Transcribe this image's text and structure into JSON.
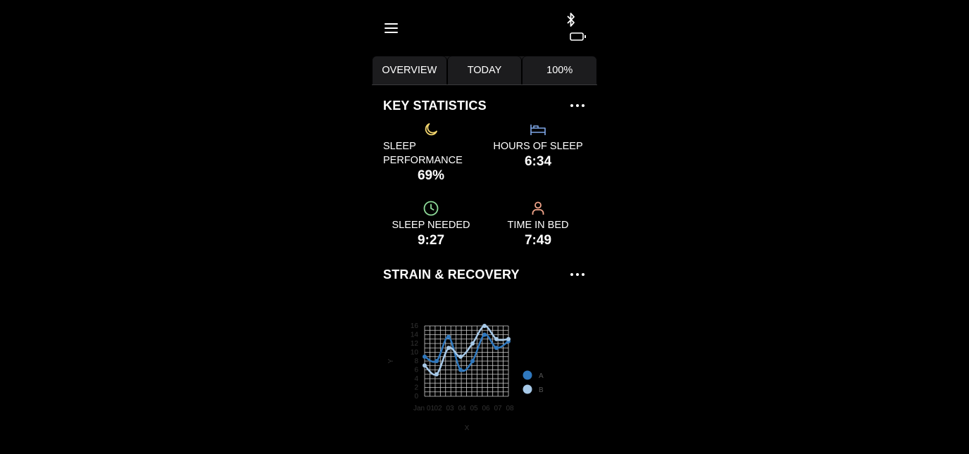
{
  "header": {
    "menu_icon": "hamburger-menu-icon",
    "bluetooth_icon": "bluetooth-icon",
    "battery_icon": "battery-icon"
  },
  "tabs": [
    {
      "label": "OVERVIEW"
    },
    {
      "label": "TODAY"
    },
    {
      "label": "100%"
    }
  ],
  "key_statistics": {
    "title": "KEY STATISTICS",
    "stats": [
      {
        "icon": "moon-icon",
        "icon_color": "#f5d76e",
        "label_line1": "SLEEP",
        "label_line2": "PERFORMANCE",
        "value": "69%"
      },
      {
        "icon": "bed-icon",
        "icon_color": "#7fa7e8",
        "label": "HOURS OF SLEEP",
        "value": "6:34"
      },
      {
        "icon": "clock-icon",
        "icon_color": "#8fdc9a",
        "label": "SLEEP NEEDED",
        "value": "9:27"
      },
      {
        "icon": "user-icon",
        "icon_color": "#f2a58a",
        "label": "TIME IN BED",
        "value": "7:49"
      }
    ]
  },
  "strain_recovery": {
    "title": "STRAIN & RECOVERY"
  },
  "chart_data": {
    "type": "line",
    "x": [
      "Jan 01",
      "Jan 02",
      "Jan 03",
      "Jan 04",
      "Jan 05",
      "Jan 06",
      "Jan 07",
      "Jan 08"
    ],
    "x_tick_labels": [
      "Jan 01",
      "02",
      "03",
      "04",
      "05",
      "06",
      "07",
      "08"
    ],
    "series": [
      {
        "name": "A",
        "color": "#2f78be",
        "values": [
          9,
          8,
          13.5,
          6,
          8,
          14,
          11,
          12.5
        ]
      },
      {
        "name": "B",
        "color": "#a7c9e8",
        "values": [
          7,
          5,
          11,
          9,
          12,
          16,
          13,
          13
        ]
      }
    ],
    "ylim": [
      0,
      16
    ],
    "y_ticks": [
      0,
      2,
      4,
      6,
      8,
      10,
      12,
      14,
      16
    ],
    "xlabel": "X",
    "ylabel": "Y",
    "grid": true,
    "legend_position": "right"
  }
}
